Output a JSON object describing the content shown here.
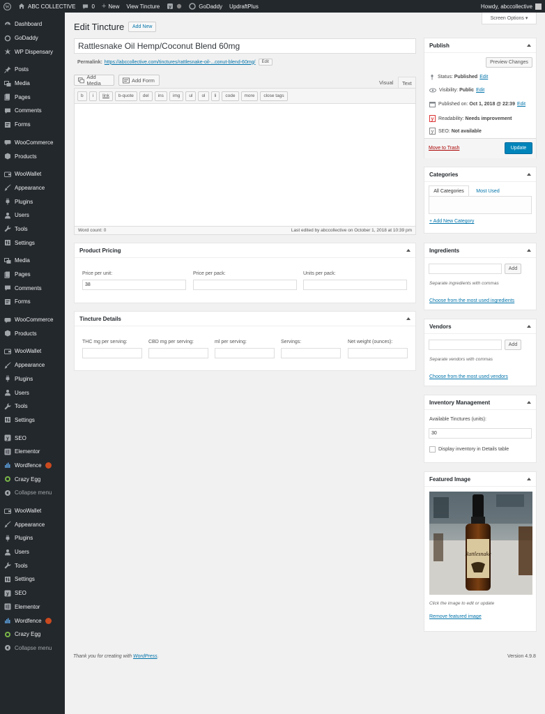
{
  "admin_bar": {
    "site_name": "ABC COLLECTIVE",
    "comments_count": "0",
    "new_label": "New",
    "view_label": "View Tincture",
    "godaddy_label": "GoDaddy",
    "updraft_label": "UpdraftPlus",
    "howdy": "Howdy, abccollective"
  },
  "sidebar": {
    "items": [
      {
        "label": "Dashboard",
        "icon": "dashboard-icon"
      },
      {
        "label": "GoDaddy",
        "icon": "godaddy-icon"
      },
      {
        "label": "WP Dispensary",
        "icon": "dispensary-icon"
      },
      {
        "label": "Posts",
        "icon": "pin-icon"
      },
      {
        "label": "Media",
        "icon": "media-icon"
      },
      {
        "label": "Pages",
        "icon": "pages-icon"
      },
      {
        "label": "Comments",
        "icon": "comments-icon"
      },
      {
        "label": "Forms",
        "icon": "forms-icon"
      },
      {
        "label": "WooCommerce",
        "icon": "woocommerce-icon"
      },
      {
        "label": "Products",
        "icon": "products-icon"
      },
      {
        "label": "WooWallet",
        "icon": "wallet-icon"
      },
      {
        "label": "Appearance",
        "icon": "brush-icon"
      },
      {
        "label": "Plugins",
        "icon": "plugins-icon"
      },
      {
        "label": "Users",
        "icon": "users-icon"
      },
      {
        "label": "Tools",
        "icon": "tools-icon"
      },
      {
        "label": "Settings",
        "icon": "settings-icon"
      },
      {
        "label": "Media",
        "icon": "media-icon"
      },
      {
        "label": "Pages",
        "icon": "pages-icon"
      },
      {
        "label": "Comments",
        "icon": "comments-icon"
      },
      {
        "label": "Forms",
        "icon": "forms-icon"
      },
      {
        "label": "WooCommerce",
        "icon": "woocommerce-icon"
      },
      {
        "label": "Products",
        "icon": "products-icon"
      },
      {
        "label": "WooWallet",
        "icon": "wallet-icon"
      },
      {
        "label": "Appearance",
        "icon": "brush-icon"
      },
      {
        "label": "Plugins",
        "icon": "plugins-icon"
      },
      {
        "label": "Users",
        "icon": "users-icon"
      },
      {
        "label": "Tools",
        "icon": "tools-icon"
      },
      {
        "label": "Settings",
        "icon": "settings-icon"
      },
      {
        "label": "SEO",
        "icon": "yoast-icon"
      },
      {
        "label": "Elementor",
        "icon": "elementor-icon"
      },
      {
        "label": "Wordfence",
        "icon": "wordfence-icon"
      },
      {
        "label": "Crazy Egg",
        "icon": "crazyegg-icon"
      },
      {
        "label": "Collapse menu",
        "icon": "collapse-icon"
      },
      {
        "label": "WooWallet",
        "icon": "wallet-icon"
      },
      {
        "label": "Appearance",
        "icon": "brush-icon"
      },
      {
        "label": "Plugins",
        "icon": "plugins-icon"
      },
      {
        "label": "Users",
        "icon": "users-icon"
      },
      {
        "label": "Tools",
        "icon": "tools-icon"
      },
      {
        "label": "Settings",
        "icon": "settings-icon"
      },
      {
        "label": "SEO",
        "icon": "yoast-icon"
      },
      {
        "label": "Elementor",
        "icon": "elementor-icon"
      },
      {
        "label": "Wordfence",
        "icon": "wordfence-icon"
      },
      {
        "label": "Crazy Egg",
        "icon": "crazyegg-icon"
      },
      {
        "label": "Collapse menu",
        "icon": "collapse-icon"
      }
    ]
  },
  "page": {
    "heading": "Edit Tincture",
    "add_new": "Add New",
    "screen_options": "Screen Options ▾",
    "post_title": "Rattlesnake Oil Hemp/Coconut Blend 60mg",
    "permalink_label": "Permalink:",
    "permalink_url": "https://abccollective.com/tinctures/rattlesnake-oil-...conut-blend-60mg/",
    "permalink_edit": "Edit"
  },
  "editor": {
    "add_media": "Add Media",
    "add_form": "Add Form",
    "tab_visual": "Visual",
    "tab_text": "Text",
    "quicktags": [
      "b",
      "i",
      "link",
      "b-quote",
      "del",
      "ins",
      "img",
      "ul",
      "ol",
      "li",
      "code",
      "more",
      "close tags"
    ],
    "word_count": "Word count: 0",
    "last_edited": "Last edited by abccollective on October 1, 2018 at 10:39 pm"
  },
  "product_pricing": {
    "title": "Product Pricing",
    "price_unit_label": "Price per unit:",
    "price_unit_value": "38",
    "price_pack_label": "Price per pack:",
    "units_pack_label": "Units per pack:"
  },
  "tincture_details": {
    "title": "Tincture Details",
    "thc_label": "THC mg per serving:",
    "cbd_label": "CBD mg per serving:",
    "ml_label": "ml per serving:",
    "servings_label": "Servings:",
    "net_weight_label": "Net weight (ounces):"
  },
  "publish": {
    "title": "Publish",
    "preview": "Preview Changes",
    "status_label": "Status:",
    "status_value": "Published",
    "visibility_label": "Visibility:",
    "visibility_value": "Public",
    "published_label": "Published on:",
    "published_value": "Oct 1, 2018 @ 22:39",
    "readability_label": "Readability:",
    "readability_value": "Needs improvement",
    "seo_label": "SEO:",
    "seo_value": "Not available",
    "edit": "Edit",
    "trash": "Move to Trash",
    "update": "Update"
  },
  "categories": {
    "title": "Categories",
    "tab_all": "All Categories",
    "tab_most": "Most Used",
    "add_new": "+ Add New Category"
  },
  "ingredients": {
    "title": "Ingredients",
    "add": "Add",
    "hint": "Separate ingredients with commas",
    "choose": "Choose from the most used ingredients"
  },
  "vendors": {
    "title": "Vendors",
    "add": "Add",
    "hint": "Separate vendors with commas",
    "choose": "Choose from the most used vendors"
  },
  "inventory": {
    "title": "Inventory Management",
    "available_label": "Available Tinctures (units):",
    "available_value": "30",
    "display_label": "Display inventory in Details table"
  },
  "featured_image": {
    "title": "Featured Image",
    "label_text": "Rattlesnake",
    "hint": "Click the image to edit or update",
    "remove": "Remove featured image"
  },
  "footer": {
    "thanks_prefix": "Thank you for creating with",
    "wordpress": "WordPress",
    "version": "Version 4.9.8"
  },
  "colors": {
    "accent": "#0073aa",
    "primary_button": "#0085ba",
    "sidebar_bg": "#23282d",
    "trash": "#a00"
  }
}
